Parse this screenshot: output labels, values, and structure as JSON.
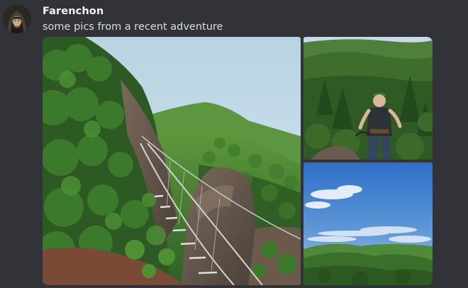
{
  "message": {
    "author": "Farenchon",
    "text": "some pics from a recent adventure"
  },
  "attachments": [
    {
      "description": "via-ferrata-bridge-photo"
    },
    {
      "description": "climber-portrait-photo"
    },
    {
      "description": "mountain-sky-photo"
    }
  ],
  "colors": {
    "background": "#313338",
    "username": "#f2f3f5",
    "text": "#dbdee1"
  }
}
